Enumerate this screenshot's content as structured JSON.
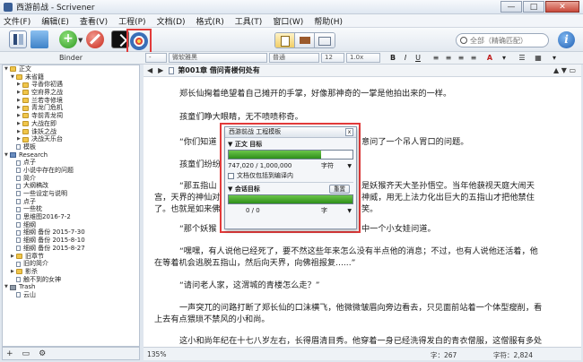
{
  "window": {
    "title": "西游前战 - Scrivener",
    "minimize": "—",
    "maximize": "□",
    "close": "✕"
  },
  "menu": [
    "文件(F)",
    "编辑(E)",
    "查看(V)",
    "工程(P)",
    "文档(D)",
    "格式(R)",
    "工具(T)",
    "窗口(W)",
    "帮助(H)"
  ],
  "toolbar": {
    "search_placeholder": "全部（精确匹配）",
    "info": "i"
  },
  "formatbar": {
    "binder_label": "Binder",
    "style": "-",
    "font": "微软雅黑",
    "weight": "普通",
    "size": "12",
    "spacing": "1.0x",
    "bold": "B",
    "italic": "I",
    "underline": "U"
  },
  "binder": {
    "items": [
      {
        "label": "正文",
        "icon": "folder",
        "indent": 0,
        "tri": "▼"
      },
      {
        "label": "未省籍",
        "icon": "folder",
        "indent": 1,
        "tri": "▼"
      },
      {
        "label": "寻香你初遇",
        "icon": "folder",
        "indent": 2,
        "tri": "▶"
      },
      {
        "label": "空府界之战",
        "icon": "folder",
        "indent": 2,
        "tri": "▶"
      },
      {
        "label": "兰若寺修境",
        "icon": "folder",
        "indent": 2,
        "tri": "▶"
      },
      {
        "label": "青龙门危机",
        "icon": "folder",
        "indent": 2,
        "tri": "▶"
      },
      {
        "label": "寺前青龙祠",
        "icon": "folder",
        "indent": 2,
        "tri": "▶"
      },
      {
        "label": "大战在即",
        "icon": "folder",
        "indent": 2,
        "tri": "▶"
      },
      {
        "label": "诛妖之战",
        "icon": "folder",
        "indent": 2,
        "tri": "▶"
      },
      {
        "label": "决战天乐台",
        "icon": "folder",
        "indent": 2,
        "tri": "▶"
      },
      {
        "label": "模板",
        "icon": "doc",
        "indent": 1,
        "tri": ""
      },
      {
        "label": "Research",
        "icon": "research",
        "indent": 0,
        "tri": "▼"
      },
      {
        "label": "点子",
        "icon": "doc",
        "indent": 1,
        "tri": ""
      },
      {
        "label": "小说中存在的问题",
        "icon": "doc",
        "indent": 1,
        "tri": ""
      },
      {
        "label": "简介",
        "icon": "doc",
        "indent": 1,
        "tri": ""
      },
      {
        "label": "大纲稿改",
        "icon": "doc",
        "indent": 1,
        "tri": ""
      },
      {
        "label": "一些设定与说明",
        "icon": "doc",
        "indent": 1,
        "tri": ""
      },
      {
        "label": "点子",
        "icon": "doc",
        "indent": 1,
        "tri": ""
      },
      {
        "label": "一些枕",
        "icon": "doc",
        "indent": 1,
        "tri": ""
      },
      {
        "label": "思维图2016-7-2",
        "icon": "doc",
        "indent": 1,
        "tri": ""
      },
      {
        "label": "细纲",
        "icon": "doc",
        "indent": 1,
        "tri": ""
      },
      {
        "label": "细纲 备份 2015-7-30",
        "icon": "doc",
        "indent": 1,
        "tri": ""
      },
      {
        "label": "细纲 备份 2015-8-10",
        "icon": "doc",
        "indent": 1,
        "tri": ""
      },
      {
        "label": "细纲 备份 2015-8-27",
        "icon": "doc",
        "indent": 1,
        "tri": ""
      },
      {
        "label": "旧章节",
        "icon": "folder",
        "indent": 1,
        "tri": "▶"
      },
      {
        "label": "旧的简介",
        "icon": "doc",
        "indent": 1,
        "tri": ""
      },
      {
        "label": "影杀",
        "icon": "folder",
        "indent": 1,
        "tri": "▶"
      },
      {
        "label": "触不到的女神",
        "icon": "doc",
        "indent": 1,
        "tri": ""
      },
      {
        "label": "Trash",
        "icon": "trash",
        "indent": 0,
        "tri": "▼"
      },
      {
        "label": "云山",
        "icon": "doc",
        "indent": 1,
        "tri": ""
      }
    ],
    "footer": {
      "add": "+",
      "folder": "▭",
      "settings": "⚙"
    }
  },
  "editor": {
    "nav_left": "◀",
    "nav_right": "▶",
    "header_title": "第001章 借问青楼何处有",
    "header_right": "▲ ▼ ▭",
    "paragraphs": [
      "郑长仙掬着绝望着自己摊开的手掌，好像那神奇的一掌是他拍出来的一样。",
      "孩童们睁大眼睛，无不啧啧称奇。",
      "“你们知道",
      "意问了一个吊人胃口的问题。",
      "孩童们纷纷",
      "“那五指山",
      "是妖猴齐天大圣孙悟空。当年他藐视天庭大闹天",
      "宫，天界的神仙对",
      "神威，用无上法力化出巨大的五指山才把他禁住",
      "了。也就是如来佛",
      "笑。",
      "“那个妖猴",
      "中一个小女娃问道。",
      "“嘿嘿，有人说他已经死了，要不然这些年来怎么没有半点他的消息；不过，也有人说他还活着，他",
      "在等着机会逃脱五指山，然后向天界，向佛祖报复......”",
      "“请问老人家，这渭城的青楼怎么走？”",
      "一声突兀的问路打断了郑长仙的口沫横飞，他微微皱眉向旁边看去，只见面前站着一个体型瘦削，看",
      "上去有点猥琐不禁风的小和尚。",
      "这小和尚年纪在十七八岁左右，长得眉清目秀。他穿着一身已经洗得发白的青衣僧服，这僧服有多处"
    ]
  },
  "status": {
    "zoom": "135%",
    "words": "字：267",
    "chars": "字符：2,824"
  },
  "dialog": {
    "title": "西游前战 工程模板",
    "close": "x",
    "section1": "▼ 正文 目标",
    "progress1": 0.747,
    "count1": "747,020 / 1,000,000",
    "unit1": "字符",
    "checkbox_label": "文档仅包括到编译内",
    "section2": "▼ 会话目标",
    "reset": "重置",
    "progress2": 1.0,
    "count2": "0 / 0",
    "unit2": "字"
  }
}
